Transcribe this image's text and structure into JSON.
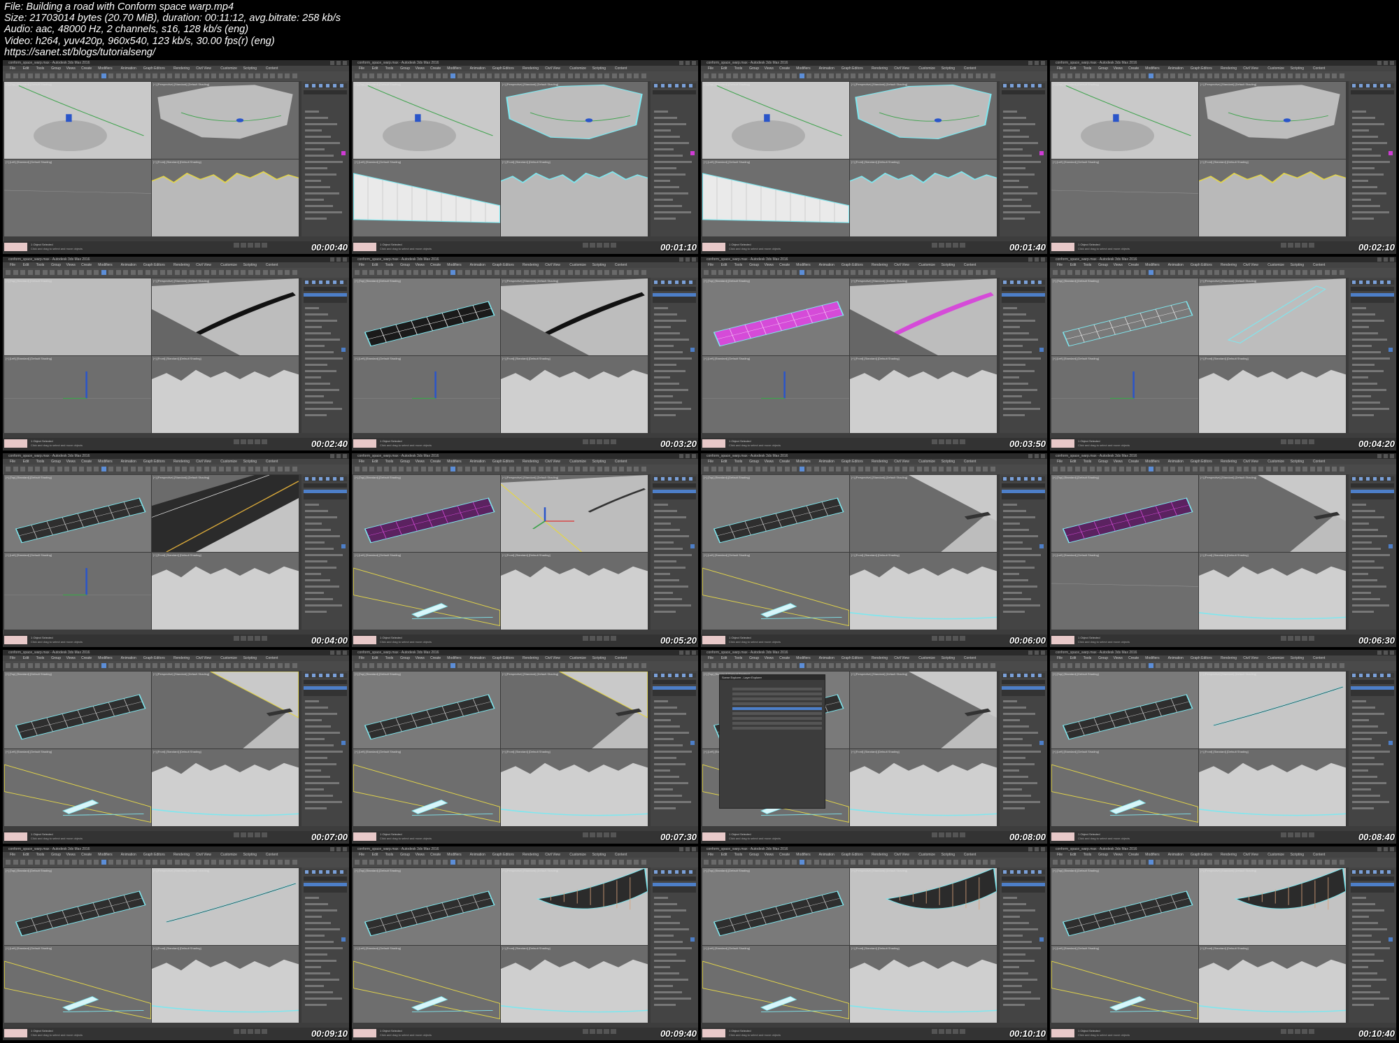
{
  "header": {
    "file_line": "File: Building a road with Conform space warp.mp4",
    "size_line": "Size: 21703014 bytes (20.70 MiB), duration: 00:11:12, avg.bitrate: 258 kb/s",
    "audio_line": "Audio: aac, 48000 Hz, 2 channels, s16, 128 kb/s (eng)",
    "video_line": "Video: h264, yuv420p, 960x540, 123 kb/s, 30.00 fps(r) (eng)",
    "url_line": "https://sanet.st/blogs/tutorialseng/"
  },
  "app": {
    "title": "conform_space_warp.max - Autodesk 3ds Max 2016",
    "menus": [
      "File",
      "Edit",
      "Tools",
      "Group",
      "Views",
      "Create",
      "Modifiers",
      "Animation",
      "Graph Editors",
      "Rendering",
      "Civil View",
      "Customize",
      "Scripting",
      "Content"
    ],
    "viewport_labels": [
      "[+] [Top] [Standard] [Default Shading]",
      "[+] [Perspective] [Standard] [Default Shading]",
      "[+] [Left] [Standard] [Default Shading]",
      "[+] [Front] [Standard] [Default Shading]"
    ],
    "status_text": "1 Object Selected",
    "prompt_text": "Click and drag to select and move objects",
    "layer_explorer_title": "Scene Explorer - Layer Explorer",
    "layer_explorer_menus": [
      "Select",
      "Display",
      "Edit",
      "Customize"
    ]
  },
  "colors": {
    "selection_cyan": "#7fe7ef",
    "active_yellow": "#e3d54a",
    "road_magenta": "#d54bd8",
    "ui_blue": "#4d7fc9",
    "terrain_gray": "#b9b9b9"
  },
  "frames": [
    {
      "timestamp": "00:00:40",
      "scene": "terrain",
      "cmd": "create",
      "left": "none",
      "persp": "terrain_spline"
    },
    {
      "timestamp": "00:01:10",
      "scene": "terrain",
      "cmd": "create",
      "left": "wire",
      "persp": "terrain_sel"
    },
    {
      "timestamp": "00:01:40",
      "scene": "terrain",
      "cmd": "create",
      "left": "wire",
      "persp": "terrain_sel"
    },
    {
      "timestamp": "00:02:10",
      "scene": "terrain",
      "cmd": "create",
      "left": "none",
      "persp": "terrain_spline"
    },
    {
      "timestamp": "00:02:40",
      "scene": "road",
      "top": "blank",
      "persp": "road_black"
    },
    {
      "timestamp": "00:03:20",
      "scene": "road",
      "top": "road_black",
      "persp": "road_black"
    },
    {
      "timestamp": "00:03:50",
      "scene": "road",
      "top": "road_magenta",
      "persp": "road_magenta"
    },
    {
      "timestamp": "00:04:20",
      "scene": "road",
      "top": "road_wire",
      "persp": "road_wire"
    },
    {
      "timestamp": "00:04:00",
      "scene": "road",
      "top": "road_grid",
      "persp": "asphalt"
    },
    {
      "timestamp": "00:05:20",
      "scene": "road",
      "top": "road_purple",
      "persp": "gizmo"
    },
    {
      "timestamp": "00:06:00",
      "scene": "road",
      "top": "road_grid",
      "persp": "slope"
    },
    {
      "timestamp": "00:06:30",
      "scene": "road",
      "top": "road_purple",
      "persp": "slope"
    },
    {
      "timestamp": "00:07:00",
      "scene": "road",
      "top": "road_grid",
      "persp": "slope_sel"
    },
    {
      "timestamp": "00:07:30",
      "scene": "road",
      "top": "road_grid",
      "persp": "slope_sel"
    },
    {
      "timestamp": "00:08:00",
      "scene": "explorer",
      "top": "road_grid",
      "persp": "slope"
    },
    {
      "timestamp": "00:08:40",
      "scene": "road",
      "top": "road_grid",
      "persp": "ribbon"
    },
    {
      "timestamp": "00:09:10",
      "scene": "road",
      "top": "road_grid",
      "persp": "ribbon"
    },
    {
      "timestamp": "00:09:40",
      "scene": "road",
      "top": "road_grid",
      "persp": "fan"
    },
    {
      "timestamp": "00:10:10",
      "scene": "road",
      "top": "road_grid",
      "persp": "fan"
    },
    {
      "timestamp": "00:10:40",
      "scene": "road",
      "top": "road_grid",
      "persp": "fan"
    }
  ]
}
